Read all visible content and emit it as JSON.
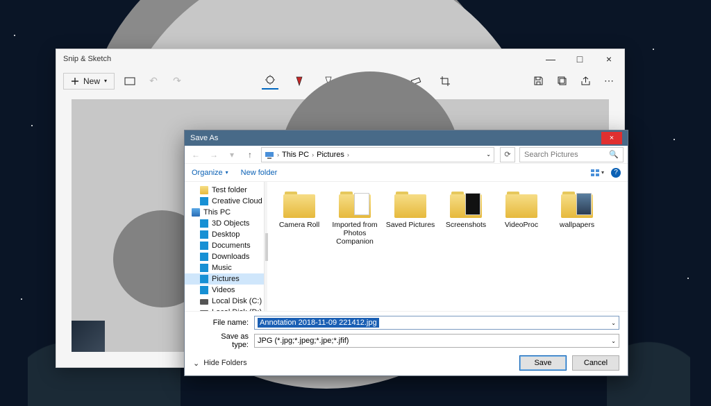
{
  "snip": {
    "title": "Snip & Sketch",
    "new_label": "New",
    "tools": {
      "touch": "touch-writing",
      "pen_red": "pen-red",
      "pen_black": "pen-black",
      "highlighter": "highlighter",
      "eraser": "eraser",
      "ruler": "ruler",
      "crop": "crop"
    },
    "right": {
      "save": "save",
      "copy": "copy",
      "share": "share",
      "more": "more"
    },
    "win": {
      "min": "—",
      "max": "□",
      "close": "×"
    }
  },
  "dlg": {
    "title": "Save As",
    "close": "×",
    "nav": {
      "back": "←",
      "forward": "→",
      "up": "↑"
    },
    "crumbs": [
      "This PC",
      "Pictures"
    ],
    "refresh_tip": "Refresh",
    "search_placeholder": "Search Pictures",
    "organize": "Organize",
    "newfolder": "New folder",
    "view_tip": "Change view",
    "help_tip": "?",
    "tree": [
      {
        "label": "Test folder",
        "icon": "fold-y",
        "indent": "sub"
      },
      {
        "label": "Creative Cloud Fil",
        "icon": "blue-ico",
        "indent": "sub"
      },
      {
        "label": "This PC",
        "icon": "pc-ico",
        "indent": ""
      },
      {
        "label": "3D Objects",
        "icon": "blue-ico",
        "indent": "sub"
      },
      {
        "label": "Desktop",
        "icon": "blue-ico",
        "indent": "sub"
      },
      {
        "label": "Documents",
        "icon": "blue-ico",
        "indent": "sub"
      },
      {
        "label": "Downloads",
        "icon": "blue-ico",
        "indent": "sub"
      },
      {
        "label": "Music",
        "icon": "blue-ico",
        "indent": "sub"
      },
      {
        "label": "Pictures",
        "icon": "blue-ico",
        "indent": "sub",
        "selected": true
      },
      {
        "label": "Videos",
        "icon": "blue-ico",
        "indent": "sub"
      },
      {
        "label": "Local Disk (C:)",
        "icon": "disk-ico",
        "indent": "sub"
      },
      {
        "label": "Local Disk (D:)",
        "icon": "disk-ico",
        "indent": "sub"
      }
    ],
    "items": [
      {
        "label": "Camera Roll",
        "thumb": ""
      },
      {
        "label": "Imported from Photos Companion",
        "thumb": "light"
      },
      {
        "label": "Saved Pictures",
        "thumb": ""
      },
      {
        "label": "Screenshots",
        "thumb": "dark"
      },
      {
        "label": "VideoProc",
        "thumb": ""
      },
      {
        "label": "wallpapers",
        "thumb": "img"
      }
    ],
    "filename_label": "File name:",
    "filename_value": "Annotation 2018-11-09 221412.jpg",
    "type_label": "Save as type:",
    "type_value": "JPG (*.jpg;*.jpeg;*.jpe;*.jfif)",
    "hide_folders": "Hide Folders",
    "save_btn": "Save",
    "cancel_btn": "Cancel"
  }
}
